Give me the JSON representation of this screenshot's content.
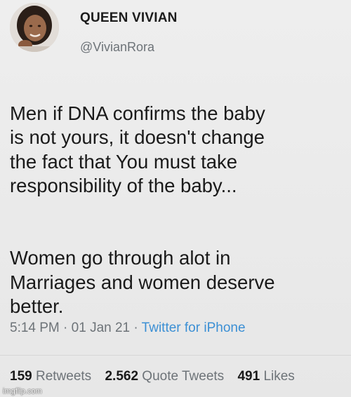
{
  "author": {
    "display_name": "QUEEN VIVIAN",
    "handle": "@VivianRora",
    "avatar_icon": "profile-photo"
  },
  "tweet": {
    "paragraph_1": "Men if DNA confirms the baby\nis not yours, it doesn't change\nthe fact that  You must take\nresponsibility of the baby...",
    "paragraph_2": "Women go through alot in\nMarriages and women deserve\nbetter.",
    "time": "5:14 PM",
    "date": "01 Jan 21",
    "separator": "·",
    "source": "Twitter for iPhone"
  },
  "stats": {
    "retweets_count": "159",
    "retweets_label": "Retweets",
    "quotes_count": "2.562",
    "quotes_label": "Quote Tweets",
    "likes_count": "491",
    "likes_label": "Likes"
  },
  "watermark": "imgflip.com",
  "colors": {
    "background": "#ebebeb",
    "link": "#3b8fd4",
    "secondary_text": "#6d7378"
  }
}
